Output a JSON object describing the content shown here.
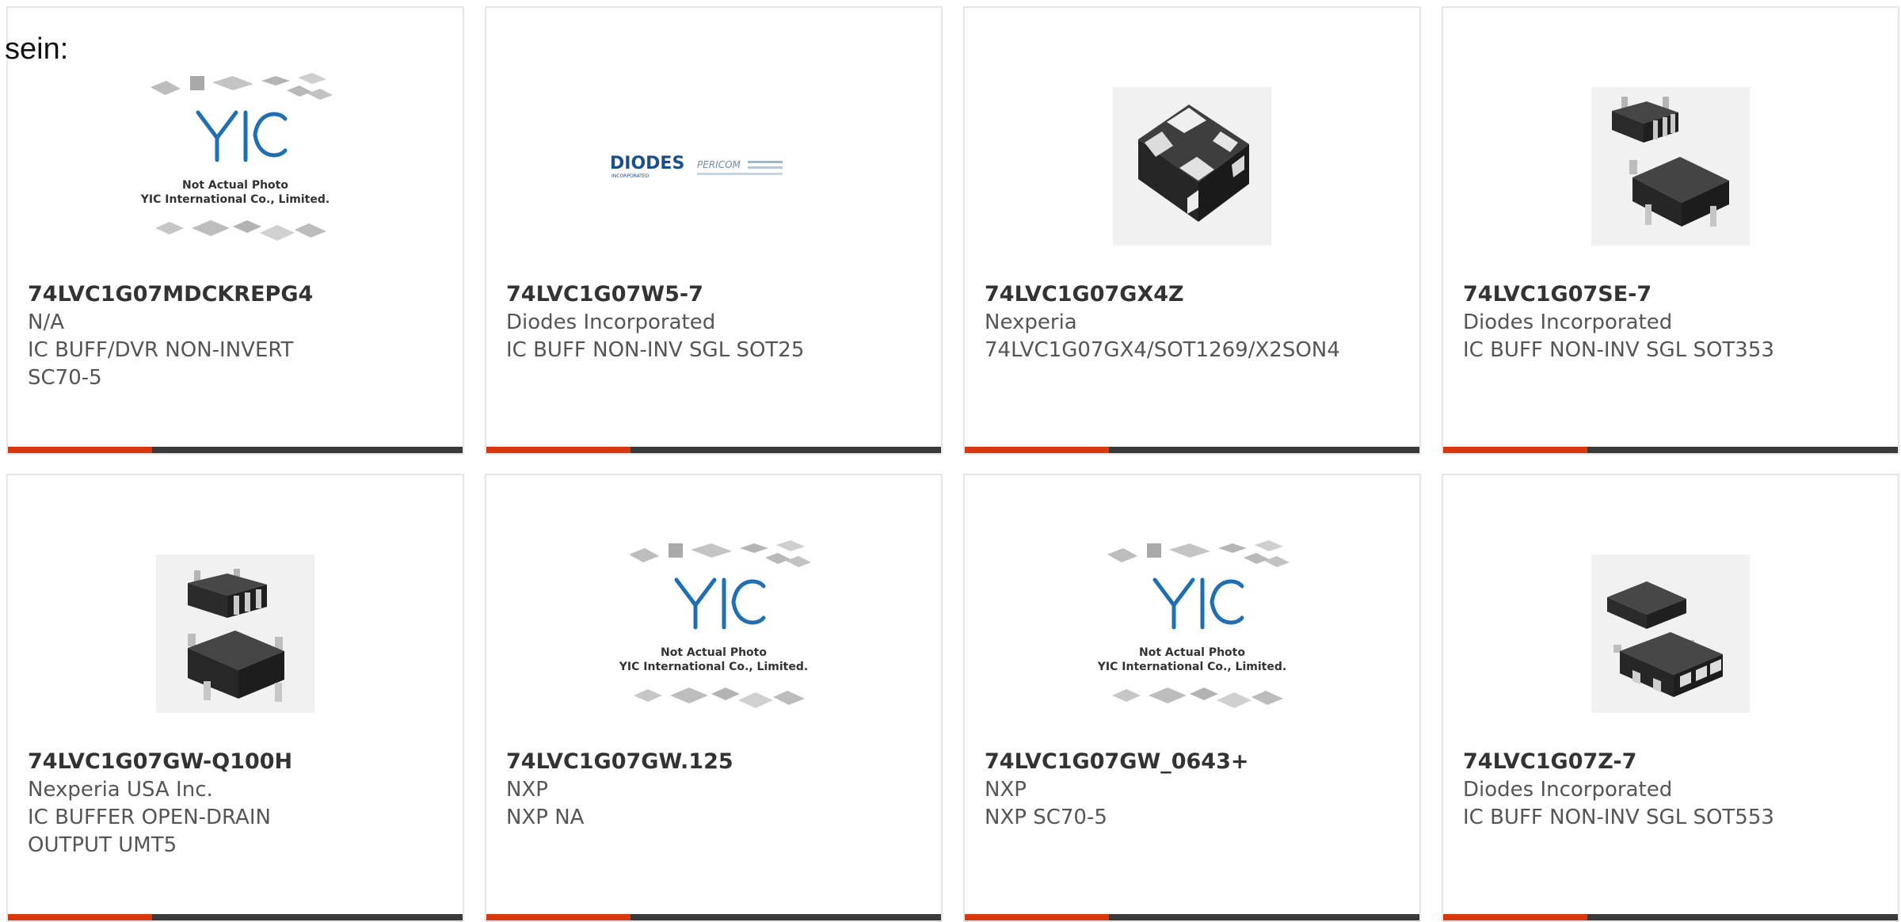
{
  "lead_text": "sein:",
  "colors": {
    "accent": "#d9380e",
    "bar": "#3a3a3a",
    "border": "#e5e5e5",
    "part_number": "#333333",
    "body_text": "#555555"
  },
  "placeholder": {
    "line1": "Not Actual Photo",
    "line2": "YIC International Co., Limited.",
    "logo": "YIC"
  },
  "diodes_logo": {
    "brand": "DIODES",
    "sub": "INCORPORATED",
    "pericom": "PERICOM"
  },
  "products": [
    {
      "part_number": "74LVC1G07MDCKREPG4",
      "manufacturer": "N/A",
      "description": "IC BUFF/DVR NON-INVERT SC70-5",
      "image": "yic-placeholder"
    },
    {
      "part_number": "74LVC1G07W5-7",
      "manufacturer": "Diodes Incorporated",
      "description": "IC BUFF NON-INV SGL SOT25",
      "image": "diodes-logo"
    },
    {
      "part_number": "74LVC1G07GX4Z",
      "manufacturer": "Nexperia",
      "description": "74LVC1G07GX4/SOT1269/X2SON4",
      "image": "x2son4-package"
    },
    {
      "part_number": "74LVC1G07SE-7",
      "manufacturer": "Diodes Incorporated",
      "description": "IC BUFF NON-INV SGL SOT353",
      "image": "sot353-package"
    },
    {
      "part_number": "74LVC1G07GW-Q100H",
      "manufacturer": "Nexperia USA Inc.",
      "description": "IC BUFFER OPEN-DRAIN OUTPUT UMT5",
      "image": "umt5-package"
    },
    {
      "part_number": "74LVC1G07GW.125",
      "manufacturer": "NXP",
      "description": "NXP NA",
      "image": "yic-placeholder"
    },
    {
      "part_number": "74LVC1G07GW_0643+",
      "manufacturer": "NXP",
      "description": "NXP SC70-5",
      "image": "yic-placeholder"
    },
    {
      "part_number": "74LVC1G07Z-7",
      "manufacturer": "Diodes Incorporated",
      "description": "IC BUFF NON-INV SGL SOT553",
      "image": "sot553-package"
    }
  ]
}
